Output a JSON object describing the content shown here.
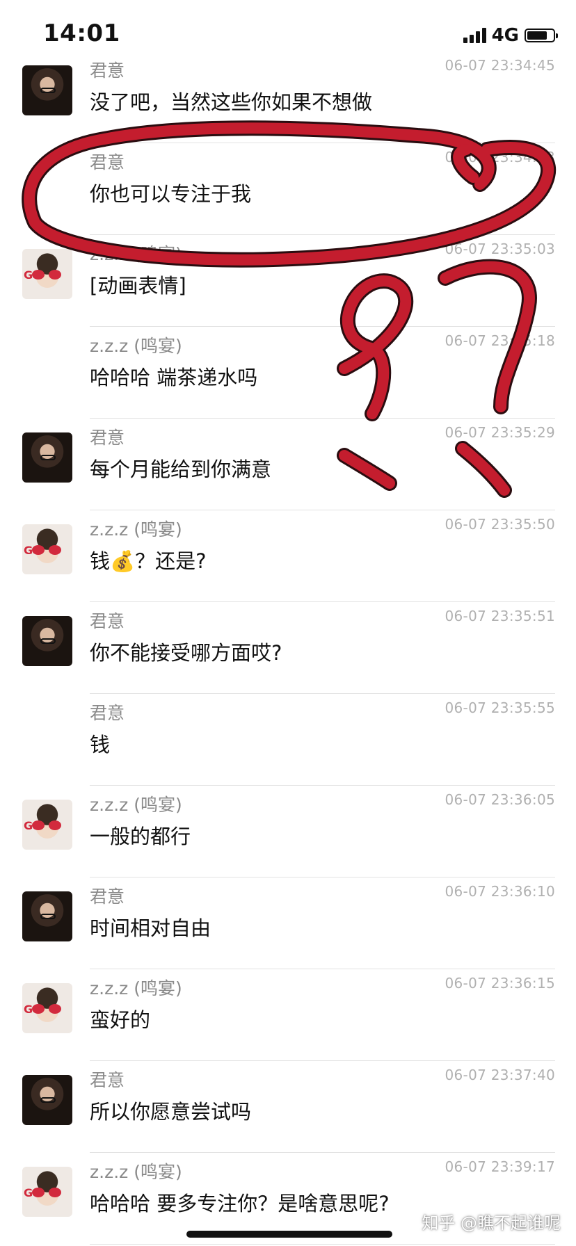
{
  "status_bar": {
    "time": "14:01",
    "network": "4G"
  },
  "messages": [
    {
      "sender": "君意",
      "time": "06-07 23:34:45",
      "text": "没了吧，当然这些你如果不想做",
      "avatar": "junyi"
    },
    {
      "sender": "君意",
      "time": "06-07 23:34:53",
      "text": "你也可以专注于我",
      "avatar": ""
    },
    {
      "sender": "z.z.z (鸣宴)",
      "time": "06-07 23:35:03",
      "text": "[动画表情]",
      "avatar": "zzz"
    },
    {
      "sender": "z.z.z (鸣宴)",
      "time": "06-07 23:35:18",
      "text": "哈哈哈 端茶递水吗",
      "avatar": ""
    },
    {
      "sender": "君意",
      "time": "06-07 23:35:29",
      "text": "每个月能给到你满意",
      "avatar": "junyi"
    },
    {
      "sender": "z.z.z (鸣宴)",
      "time": "06-07 23:35:50",
      "text": "钱💰？还是?",
      "avatar": "zzz"
    },
    {
      "sender": "君意",
      "time": "06-07 23:35:51",
      "text": "你不能接受哪方面哎?",
      "avatar": "junyi"
    },
    {
      "sender": "君意",
      "time": "06-07 23:35:55",
      "text": "钱",
      "avatar": ""
    },
    {
      "sender": "z.z.z (鸣宴)",
      "time": "06-07 23:36:05",
      "text": "一般的都行",
      "avatar": "zzz"
    },
    {
      "sender": "君意",
      "time": "06-07 23:36:10",
      "text": "时间相对自由",
      "avatar": "junyi"
    },
    {
      "sender": "z.z.z (鸣宴)",
      "time": "06-07 23:36:15",
      "text": "蛮好的",
      "avatar": "zzz"
    },
    {
      "sender": "君意",
      "time": "06-07 23:37:40",
      "text": "所以你愿意尝试吗",
      "avatar": "junyi"
    },
    {
      "sender": "z.z.z (鸣宴)",
      "time": "06-07 23:39:17",
      "text": "哈哈哈 要多专注你？是啥意思呢?",
      "avatar": "zzz"
    }
  ],
  "watermark": "知乎 @瞧不起谁呢",
  "colors": {
    "annotation": "#c41d2e",
    "annotation_outline": "#2a0d10"
  }
}
